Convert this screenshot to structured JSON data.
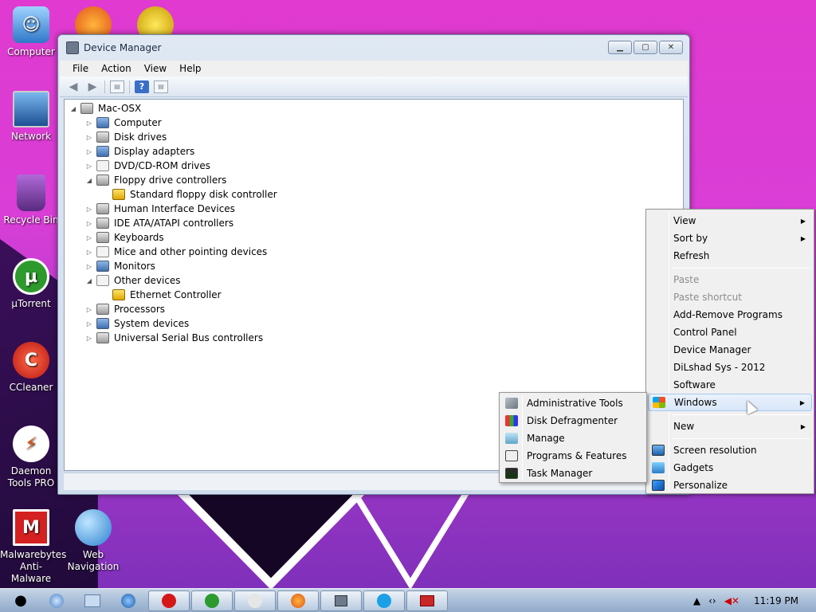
{
  "desktop": {
    "icons": [
      {
        "label": "Computer"
      },
      {
        "label": "Network"
      },
      {
        "label": "Recycle Bin"
      },
      {
        "label": "µTorrent"
      },
      {
        "label": "CCleaner"
      },
      {
        "label": "Daemon Tools PRO"
      },
      {
        "label": "Malwarebytes Anti-Malware"
      },
      {
        "label": "Web Navigation"
      }
    ]
  },
  "window": {
    "title": "Device Manager",
    "menu": [
      "File",
      "Action",
      "View",
      "Help"
    ],
    "tree": {
      "root": "Mac-OSX",
      "items": [
        {
          "label": "Computer",
          "expanded": false
        },
        {
          "label": "Disk drives",
          "expanded": false
        },
        {
          "label": "Display adapters",
          "expanded": false
        },
        {
          "label": "DVD/CD-ROM drives",
          "expanded": false
        },
        {
          "label": "Floppy drive controllers",
          "expanded": true
        },
        {
          "label": "Standard floppy disk controller",
          "child": true
        },
        {
          "label": "Human Interface Devices",
          "expanded": false
        },
        {
          "label": "IDE ATA/ATAPI controllers",
          "expanded": false
        },
        {
          "label": "Keyboards",
          "expanded": false
        },
        {
          "label": "Mice and other pointing devices",
          "expanded": false
        },
        {
          "label": "Monitors",
          "expanded": false
        },
        {
          "label": "Other devices",
          "expanded": true
        },
        {
          "label": "Ethernet Controller",
          "child": true,
          "warning": true
        },
        {
          "label": "Processors",
          "expanded": false
        },
        {
          "label": "System devices",
          "expanded": false
        },
        {
          "label": "Universal Serial Bus controllers",
          "expanded": false
        }
      ]
    }
  },
  "context_menu": {
    "items": [
      {
        "label": "View",
        "submenu": true
      },
      {
        "label": "Sort by",
        "submenu": true
      },
      {
        "label": "Refresh"
      },
      {
        "label": "Paste",
        "disabled": true
      },
      {
        "label": "Paste shortcut",
        "disabled": true
      },
      {
        "label": "Add-Remove Programs"
      },
      {
        "label": "Control Panel"
      },
      {
        "label": "Device Manager"
      },
      {
        "label": "DiLshad Sys - 2012"
      },
      {
        "label": "Software"
      },
      {
        "label": "Windows",
        "submenu": true,
        "highlighted": true
      },
      {
        "label": "New",
        "submenu": true
      },
      {
        "label": "Screen resolution"
      },
      {
        "label": "Gadgets"
      },
      {
        "label": "Personalize"
      }
    ]
  },
  "submenu": {
    "items": [
      {
        "label": "Administrative Tools"
      },
      {
        "label": "Disk Defragmenter"
      },
      {
        "label": "Manage"
      },
      {
        "label": "Programs & Features"
      },
      {
        "label": "Task Manager"
      }
    ]
  },
  "taskbar": {
    "clock": "11:19 PM"
  },
  "colors": {
    "desktop_magenta": "#d93ed6",
    "menu_bg": "#f0f0f0",
    "highlight": "#d9e7f9"
  }
}
